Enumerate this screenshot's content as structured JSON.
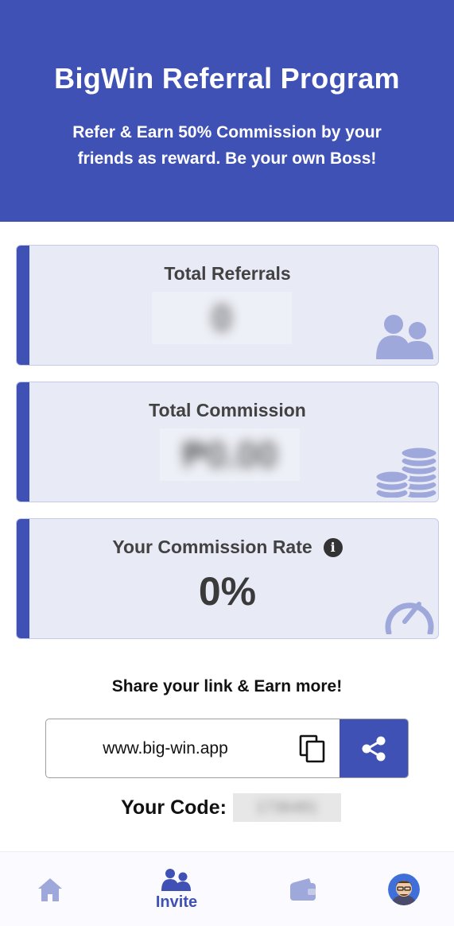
{
  "header": {
    "title": "BigWin Referral Program",
    "subtitle": "Refer & Earn 50% Commission by your friends as reward. Be your own Boss!"
  },
  "cards": {
    "referrals": {
      "title": "Total Referrals",
      "value": "0",
      "icon": "users-icon"
    },
    "commission": {
      "title": "Total Commission",
      "value": "₱0.00",
      "icon": "coins-icon"
    },
    "rate": {
      "title": "Your Commission Rate",
      "value": "0%",
      "icon": "speedometer-icon",
      "info_glyph": "i"
    }
  },
  "share": {
    "heading": "Share your link & Earn more!",
    "link": "www.big-win.app",
    "copy_icon": "copy-icon",
    "share_icon": "share-icon"
  },
  "code": {
    "label": "Your Code:",
    "value": "1736481"
  },
  "nav": {
    "items": [
      {
        "id": "home",
        "icon": "home-icon",
        "label": ""
      },
      {
        "id": "invite",
        "icon": "users-icon",
        "label": "Invite",
        "active": true
      },
      {
        "id": "wallet",
        "icon": "wallet-icon",
        "label": ""
      },
      {
        "id": "profile",
        "icon": "avatar",
        "label": ""
      }
    ]
  },
  "colors": {
    "primary": "#3f51b5",
    "card_bg": "#e8eaf6",
    "icon_light": "#9fa8da"
  }
}
